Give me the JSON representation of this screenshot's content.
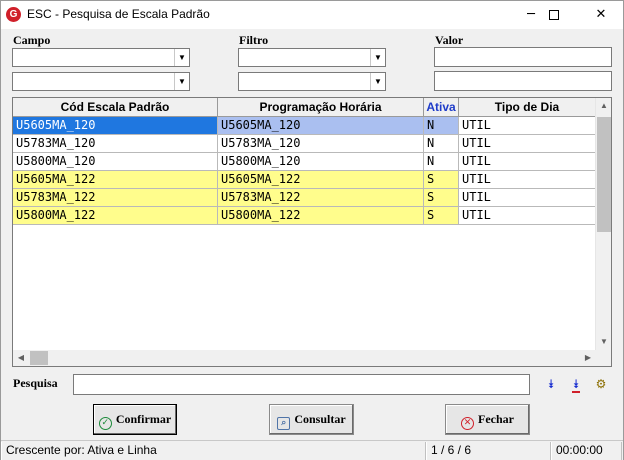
{
  "window": {
    "title": "ESC - Pesquisa de Escala Padrão",
    "app_icon": "G",
    "minimize": "─",
    "close": "✕"
  },
  "filters": {
    "campo_label": "Campo",
    "filtro_label": "Filtro",
    "valor_label": "Valor",
    "campo1": "",
    "campo2": "",
    "filtro1": "",
    "filtro2": "",
    "valor1": "",
    "valor2": ""
  },
  "grid": {
    "columns": [
      "Cód Escala Padrão",
      "Programação Horária",
      "Ativa",
      "Tipo de Dia"
    ],
    "rows": [
      {
        "cod": "U5605MA_120",
        "prog": "U5605MA_120",
        "ativa": "N",
        "tipo": "UTIL"
      },
      {
        "cod": "U5783MA_120",
        "prog": "U5783MA_120",
        "ativa": "N",
        "tipo": "UTIL"
      },
      {
        "cod": "U5800MA_120",
        "prog": "U5800MA_120",
        "ativa": "N",
        "tipo": "UTIL"
      },
      {
        "cod": "U5605MA_122",
        "prog": "U5605MA_122",
        "ativa": "S",
        "tipo": "UTIL"
      },
      {
        "cod": "U5783MA_122",
        "prog": "U5783MA_122",
        "ativa": "S",
        "tipo": "UTIL"
      },
      {
        "cod": "U5800MA_122",
        "prog": "U5800MA_122",
        "ativa": "S",
        "tipo": "UTIL"
      }
    ],
    "selected_row": 0
  },
  "search": {
    "label": "Pesquisa",
    "value": ""
  },
  "buttons": {
    "confirm": "Confirmar",
    "consult": "Consultar",
    "close": "Fechar"
  },
  "icons": {
    "confirm": "check-circle-icon",
    "consult": "magnifier-icon",
    "close": "x-circle-icon",
    "tool1": "double-chevron-down-icon",
    "tool2": "double-chevron-down-underline-icon",
    "tool3": "gear-db-icon"
  },
  "status": {
    "sort": "Crescente por: Ativa e Linha",
    "count": "1 / 6 / 6",
    "time": "00:00:00"
  },
  "colors": {
    "selected_cell": "#1f77e0",
    "selected_row": "#aabff0",
    "active_rows": "#fffd8c",
    "ativa_header": "#1f3cc9"
  }
}
